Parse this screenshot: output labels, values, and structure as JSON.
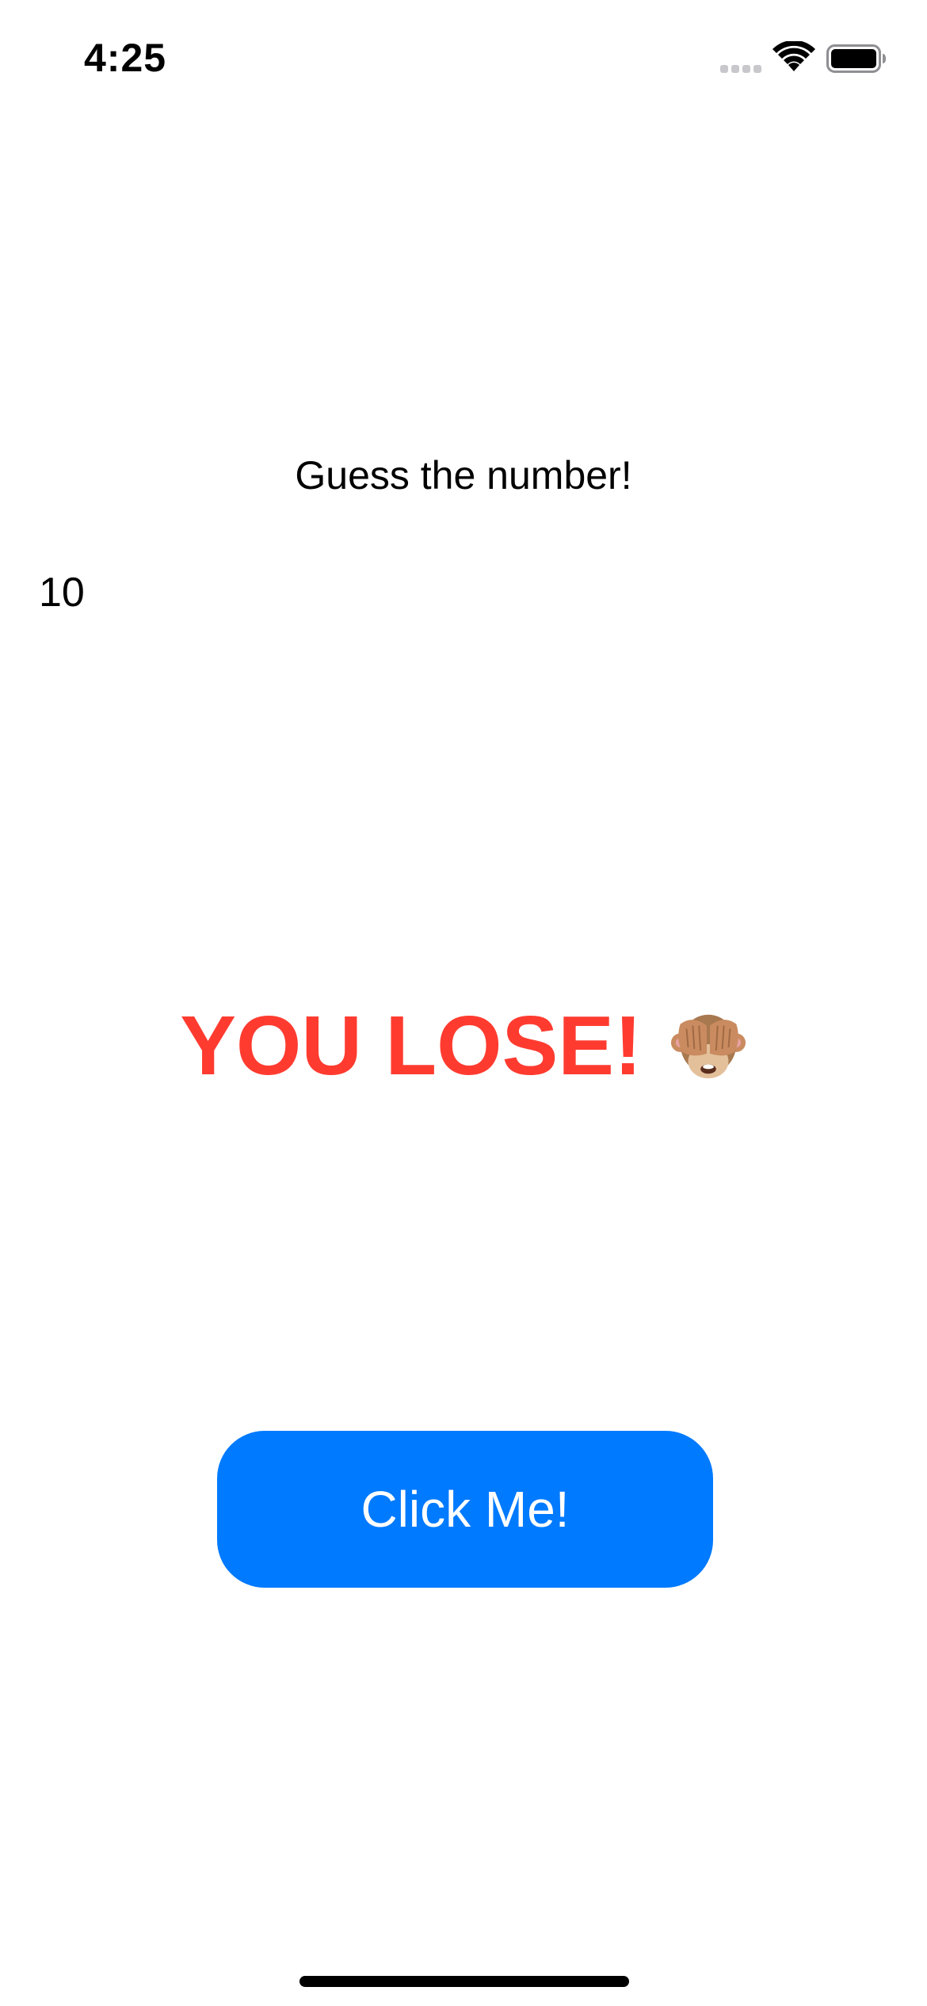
{
  "status_bar": {
    "time": "4:25",
    "signal_icon": "cellular-signal-icon",
    "wifi_icon": "wifi-icon",
    "battery_icon": "battery-icon"
  },
  "main": {
    "title": "Guess the number!",
    "count": "10",
    "result_text": "YOU LOSE!",
    "result_icon": "see-no-evil-monkey-icon",
    "result_color": "#ff3b30",
    "button_label": "Click Me!",
    "button_color": "#007aff"
  }
}
